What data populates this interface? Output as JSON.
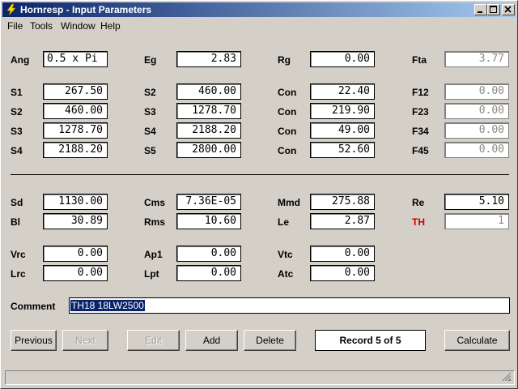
{
  "window": {
    "title": "Hornresp - Input Parameters"
  },
  "menu": {
    "file": "File",
    "tools": "Tools",
    "window": "Window",
    "help": "Help"
  },
  "params": {
    "Ang": {
      "label": "Ang",
      "value": "0.5 x Pi"
    },
    "Eg": {
      "label": "Eg",
      "value": "2.83"
    },
    "Rg": {
      "label": "Rg",
      "value": "0.00"
    },
    "Fta": {
      "label": "Fta",
      "value": "3.77"
    },
    "S1": {
      "label": "S1",
      "value": "267.50"
    },
    "S2a": {
      "label": "S2",
      "value": "460.00"
    },
    "Con1": {
      "label": "Con",
      "value": "22.40"
    },
    "F12": {
      "label": "F12",
      "value": "0.00"
    },
    "S2": {
      "label": "S2",
      "value": "460.00"
    },
    "S3a": {
      "label": "S3",
      "value": "1278.70"
    },
    "Con2": {
      "label": "Con",
      "value": "219.90"
    },
    "F23": {
      "label": "F23",
      "value": "0.00"
    },
    "S3": {
      "label": "S3",
      "value": "1278.70"
    },
    "S4a": {
      "label": "S4",
      "value": "2188.20"
    },
    "Con3": {
      "label": "Con",
      "value": "49.00"
    },
    "F34": {
      "label": "F34",
      "value": "0.00"
    },
    "S4": {
      "label": "S4",
      "value": "2188.20"
    },
    "S5": {
      "label": "S5",
      "value": "2800.00"
    },
    "Con4": {
      "label": "Con",
      "value": "52.60"
    },
    "F45": {
      "label": "F45",
      "value": "0.00"
    },
    "Sd": {
      "label": "Sd",
      "value": "1130.00"
    },
    "Cms": {
      "label": "Cms",
      "value": "7.36E-05"
    },
    "Mmd": {
      "label": "Mmd",
      "value": "275.88"
    },
    "Re": {
      "label": "Re",
      "value": "5.10"
    },
    "Bl": {
      "label": "Bl",
      "value": "30.89"
    },
    "Rms": {
      "label": "Rms",
      "value": "10.60"
    },
    "Le": {
      "label": "Le",
      "value": "2.87"
    },
    "TH": {
      "label": "TH",
      "value": "1"
    },
    "Vrc": {
      "label": "Vrc",
      "value": "0.00"
    },
    "Ap1": {
      "label": "Ap1",
      "value": "0.00"
    },
    "Vtc": {
      "label": "Vtc",
      "value": "0.00"
    },
    "Lrc": {
      "label": "Lrc",
      "value": "0.00"
    },
    "Lpt": {
      "label": "Lpt",
      "value": "0.00"
    },
    "Atc": {
      "label": "Atc",
      "value": "0.00"
    }
  },
  "comment": {
    "label": "Comment",
    "value": "TH18 18LW2500"
  },
  "buttons": {
    "previous": "Previous",
    "next": "Next",
    "edit": "Edit",
    "add": "Add",
    "delete": "Delete",
    "calculate": "Calculate"
  },
  "record": "Record 5 of 5",
  "colors": {
    "titlebar": "#0a246a",
    "th_label": "#cc0000",
    "disabled_text": "#8a8a8a"
  }
}
